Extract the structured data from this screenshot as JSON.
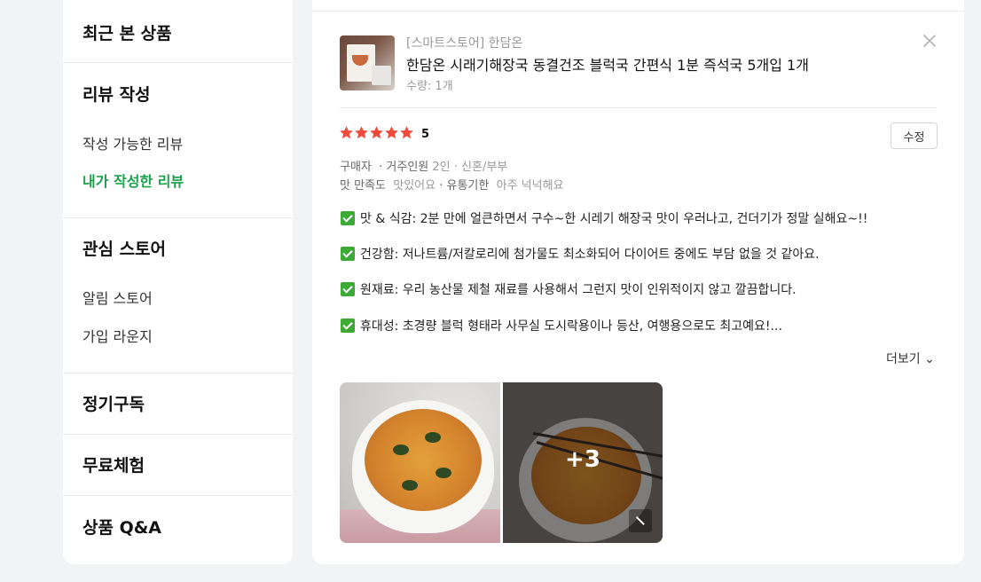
{
  "sidebar": {
    "recent": "최근 본 상품",
    "review_write": "리뷰 작성",
    "review_available": "작성 가능한 리뷰",
    "review_mine": "내가 작성한 리뷰",
    "interest_store": "관심 스토어",
    "alarm_store": "알림 스토어",
    "join_lounge": "가입 라운지",
    "subscription": "정기구독",
    "free_trial": "무료체험",
    "product_qa": "상품 Q&A"
  },
  "product": {
    "store": "[스마트스토어] 한담온",
    "title": "한담온 시래기해장국 동결건조 블럭국 간편식 1분 즉석국 5개입 1개",
    "quantity": "수량: 1개"
  },
  "review": {
    "rating": "5",
    "edit_label": "수정",
    "buyer_label": "구매자",
    "household_label": "· 거주인원",
    "household_value": "2인 · 신혼/부부",
    "taste_label": "맛 만족도",
    "taste_value": "맛있어요",
    "expiry_label": "· 유통기한",
    "expiry_value": "아주 넉넉해요",
    "lines": [
      "맛 & 식감: 2분 만에 얼큰하면서 구수~한 시레기 해장국 맛이 우러나고, 건더기가 정말 실해요~!!",
      "건강함: 저나트륨/저칼로리에 첨가물도 최소화되어 다이어트 중에도 부담 없을 것 같아요.",
      "원재료: 우리 농산물 제철 재료를 사용해서 그런지 맛이 인위적이지 않고 깔끔합니다.",
      "휴대성: 초경량 블럭 형태라 사무실 도시락용이나 등산, 여행용으로도 최고예요!..."
    ],
    "more_label": "더보기",
    "more_photos": "+3"
  },
  "colors": {
    "accent_green": "#1aa34a",
    "star_red": "#f04b3d",
    "check_green": "#3daa35"
  }
}
